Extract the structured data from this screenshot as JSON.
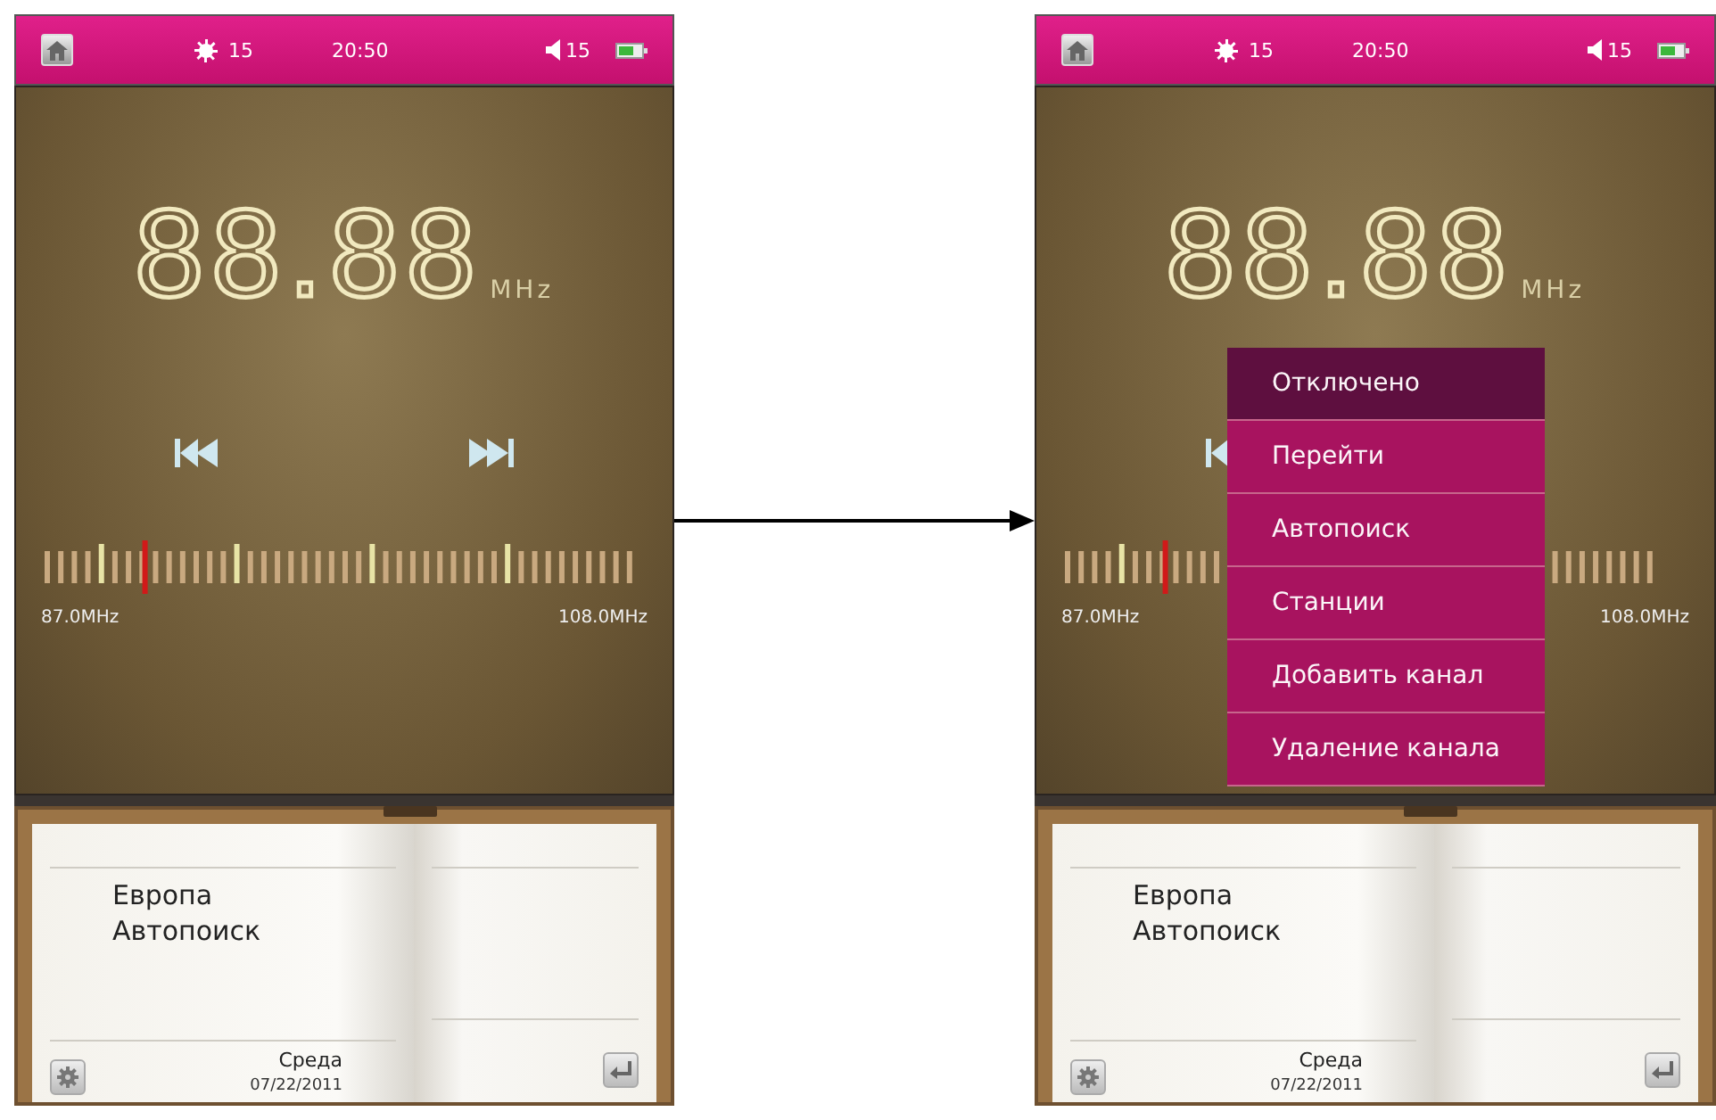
{
  "screens": [
    {
      "status_bar": {
        "brightness": "15",
        "time": "20:50",
        "volume": "15"
      },
      "frequency": "88.88",
      "unit": "MHz",
      "scale": {
        "min": "87.0MHz",
        "max": "108.0MHz",
        "level": 0.17
      },
      "book": {
        "lines": [
          "Европа",
          "Автопоиск"
        ],
        "day": "Среда",
        "date": "07/22/2011"
      }
    },
    {
      "status_bar": {
        "brightness": "15",
        "time": "20:50",
        "volume": "15"
      },
      "frequency": "88.88",
      "unit": "MHz",
      "scale": {
        "min": "87.0MHz",
        "max": "108.0MHz",
        "level": 0.17
      },
      "book": {
        "lines": [
          "Европа",
          "Автопоиск"
        ],
        "day": "Среда",
        "date": "07/22/2011"
      },
      "menu": [
        {
          "label": "Отключено",
          "selected": true
        },
        {
          "label": "Перейти",
          "selected": false
        },
        {
          "label": "Автопоиск",
          "selected": false
        },
        {
          "label": "Станции",
          "selected": false
        },
        {
          "label": "Добавить канал",
          "selected": false
        },
        {
          "label": "Удаление канала",
          "selected": false
        }
      ]
    }
  ]
}
